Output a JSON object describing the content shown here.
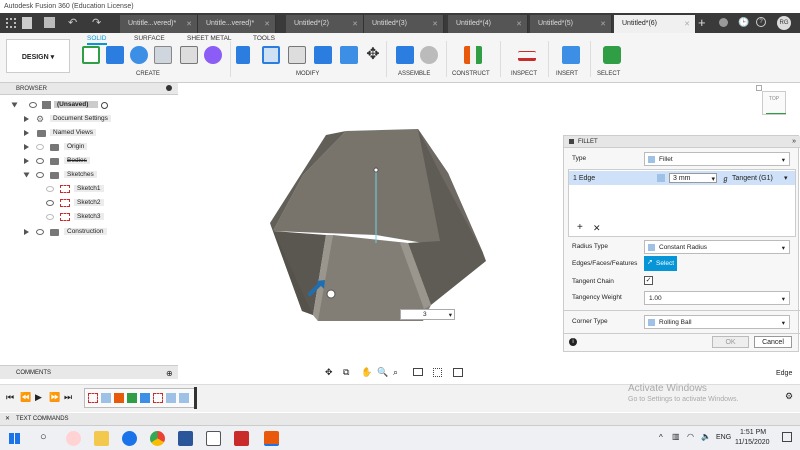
{
  "app": {
    "title": "Autodesk Fusion 360 (Education License)"
  },
  "tabs": [
    {
      "label": "Untitle...vered)*"
    },
    {
      "label": "Untitle...vered)*"
    },
    {
      "label": "Untitled*(2)"
    },
    {
      "label": "Untitled*(3)"
    },
    {
      "label": "Untitled*(4)"
    },
    {
      "label": "Untitled*(5)"
    },
    {
      "label": "Untitled*(6)"
    }
  ],
  "user_initials": "RG",
  "toolbar": {
    "workspace": "DESIGN",
    "tabs": [
      "SOLID",
      "SURFACE",
      "SHEET METAL",
      "TOOLS"
    ],
    "groups": [
      "CREATE",
      "MODIFY",
      "ASSEMBLE",
      "CONSTRUCT",
      "INSPECT",
      "INSERT",
      "SELECT"
    ]
  },
  "browser": {
    "title": "BROWSER",
    "items": [
      {
        "label": "(Unsaved)"
      },
      {
        "label": "Document Settings"
      },
      {
        "label": "Named Views"
      },
      {
        "label": "Origin"
      },
      {
        "label": "Bodies"
      },
      {
        "label": "Sketches"
      },
      {
        "label": "Sketch1"
      },
      {
        "label": "Sketch2"
      },
      {
        "label": "Sketch3"
      },
      {
        "label": "Construction"
      }
    ]
  },
  "viewcube": {
    "label": "TOP"
  },
  "fillet": {
    "title": "FILLET",
    "type_label": "Type",
    "type_value": "Fillet",
    "edges_label": "1 Edge",
    "radius_value": "3 mm",
    "tangent_value": "Tangent (G1)",
    "radius_type_label": "Radius Type",
    "radius_type_value": "Constant Radius",
    "efs_label": "Edges/Faces/Features",
    "select_button": "Select",
    "tangent_chain_label": "Tangent Chain",
    "tangent_chain_checked": true,
    "tangency_weight_label": "Tangency Weight",
    "tangency_weight_value": "1.00",
    "corner_type_label": "Corner Type",
    "corner_type_value": "Rolling Ball",
    "ok": "OK",
    "cancel": "Cancel"
  },
  "viewport_input": "3",
  "comments_label": "COMMENTS",
  "edge_label": "Edge",
  "text_commands": "TEXT COMMANDS",
  "watermark": {
    "title": "Activate Windows",
    "subtitle": "Go to Settings to activate Windows."
  },
  "taskbar": {
    "language": "ENG",
    "time": "1:51 PM",
    "date": "11/15/2020"
  }
}
